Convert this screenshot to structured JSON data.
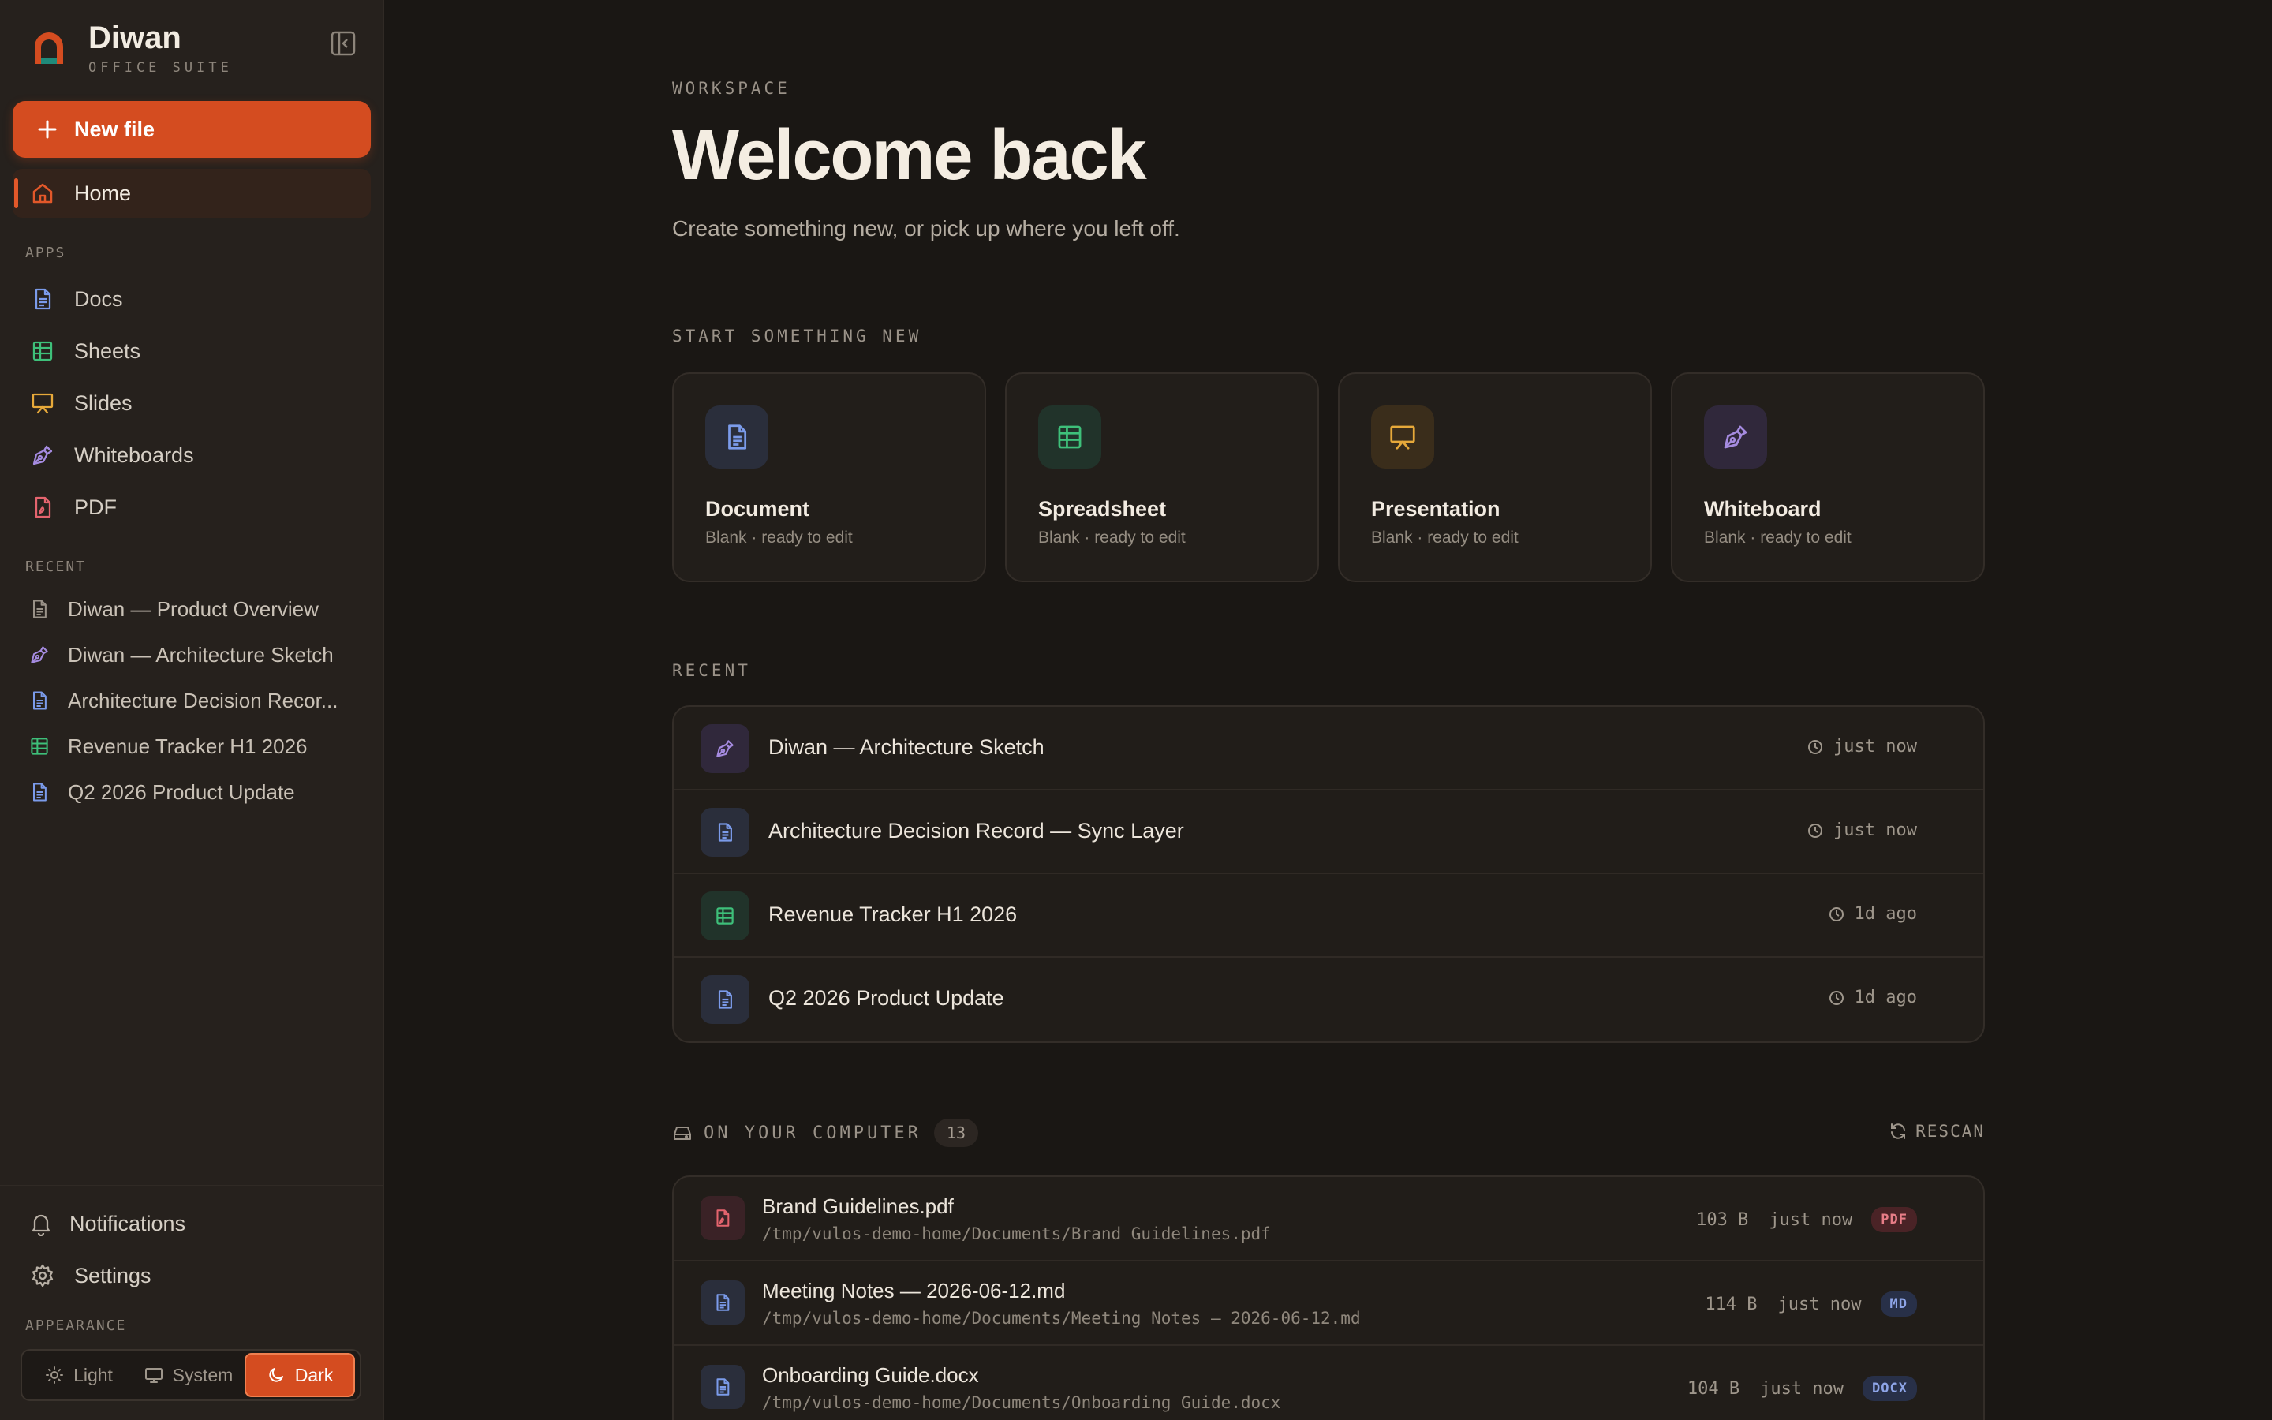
{
  "colors": {
    "accent": "#d44c20",
    "docs": "#7b9bea",
    "sheets": "#3ec07a",
    "slides": "#e7a93a",
    "whiteboards": "#a58be0",
    "pdf": "#e4646e"
  },
  "brand": {
    "name": "Diwan",
    "subtitle": "OFFICE SUITE"
  },
  "sidebar": {
    "new_file_label": "New file",
    "home_label": "Home",
    "apps_label": "APPS",
    "apps": [
      {
        "label": "Docs",
        "icon": "document-icon"
      },
      {
        "label": "Sheets",
        "icon": "table-icon"
      },
      {
        "label": "Slides",
        "icon": "presentation-icon"
      },
      {
        "label": "Whiteboards",
        "icon": "pen-icon"
      },
      {
        "label": "PDF",
        "icon": "pdf-icon"
      }
    ],
    "recent_label": "RECENT",
    "recent": [
      {
        "label": "Diwan — Product Overview",
        "icon": "document-icon"
      },
      {
        "label": "Diwan — Architecture Sketch",
        "icon": "pen-icon"
      },
      {
        "label": "Architecture Decision Recor...",
        "icon": "document-icon"
      },
      {
        "label": "Revenue Tracker H1 2026",
        "icon": "table-icon"
      },
      {
        "label": "Q2 2026 Product Update",
        "icon": "document-icon"
      }
    ],
    "notifications_label": "Notifications",
    "settings_label": "Settings",
    "appearance_label": "APPEARANCE",
    "theme": {
      "light": "Light",
      "system": "System",
      "dark": "Dark",
      "selected": "Dark"
    }
  },
  "main": {
    "kicker": "WORKSPACE",
    "title": "Welcome back",
    "subtitle": "Create something new, or pick up where you left off.",
    "start_label": "START SOMETHING NEW",
    "cards": [
      {
        "title": "Document",
        "subtitle": "Blank · ready to edit",
        "icon": "document-icon"
      },
      {
        "title": "Spreadsheet",
        "subtitle": "Blank · ready to edit",
        "icon": "table-icon"
      },
      {
        "title": "Presentation",
        "subtitle": "Blank · ready to edit",
        "icon": "presentation-icon"
      },
      {
        "title": "Whiteboard",
        "subtitle": "Blank · ready to edit",
        "icon": "pen-icon"
      }
    ],
    "recent_label": "RECENT",
    "recent": [
      {
        "name": "Diwan — Architecture Sketch",
        "time": "just now",
        "icon": "pen-icon"
      },
      {
        "name": "Architecture Decision Record — Sync Layer",
        "time": "just now",
        "icon": "document-icon"
      },
      {
        "name": "Revenue Tracker H1 2026",
        "time": "1d ago",
        "icon": "table-icon"
      },
      {
        "name": "Q2 2026 Product Update",
        "time": "1d ago",
        "icon": "document-icon"
      }
    ],
    "computer_label": "ON YOUR COMPUTER",
    "computer_count": "13",
    "rescan_label": "RESCAN",
    "files": [
      {
        "name": "Brand Guidelines.pdf",
        "path": "/tmp/vulos-demo-home/Documents/Brand Guidelines.pdf",
        "size": "103 B",
        "time": "just now",
        "badge": "PDF"
      },
      {
        "name": "Meeting Notes — 2026-06-12.md",
        "path": "/tmp/vulos-demo-home/Documents/Meeting Notes — 2026-06-12.md",
        "size": "114 B",
        "time": "just now",
        "badge": "MD"
      },
      {
        "name": "Onboarding Guide.docx",
        "path": "/tmp/vulos-demo-home/Documents/Onboarding Guide.docx",
        "size": "104 B",
        "time": "just now",
        "badge": "DOCX"
      }
    ]
  }
}
